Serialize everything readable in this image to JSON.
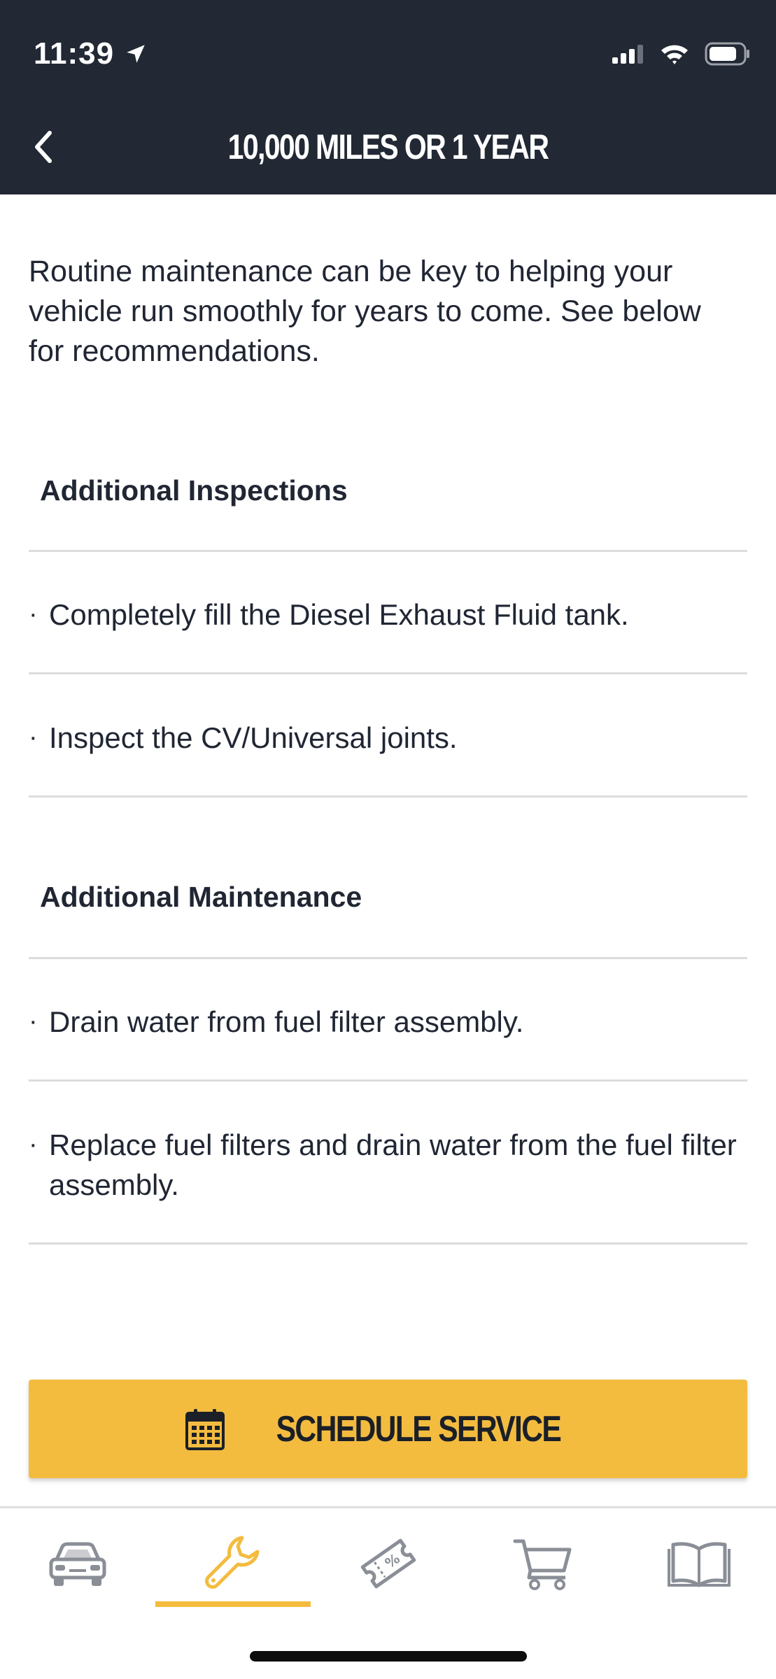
{
  "status_bar": {
    "time": "11:39"
  },
  "header": {
    "title": "10,000 MILES OR 1 YEAR"
  },
  "intro": "Routine maintenance can be key to helping your vehicle run smoothly for years to come.  See below for recommendations.",
  "sections": [
    {
      "title": "Additional Inspections",
      "items": [
        "Completely fill the Diesel Exhaust Fluid tank.",
        "Inspect the CV/Universal joints."
      ]
    },
    {
      "title": "Additional Maintenance",
      "items": [
        "Drain water from fuel filter assembly.",
        "Replace fuel filters and drain water from the fuel filter assembly."
      ]
    }
  ],
  "bullet": "·",
  "schedule_button": {
    "label": "SCHEDULE SERVICE"
  },
  "tabs": [
    {
      "icon": "car-icon",
      "active": false
    },
    {
      "icon": "wrench-icon",
      "active": true
    },
    {
      "icon": "coupon-icon",
      "active": false
    },
    {
      "icon": "cart-icon",
      "active": false
    },
    {
      "icon": "book-icon",
      "active": false
    }
  ],
  "colors": {
    "header_bg": "#222834",
    "accent": "#f3bc3f",
    "icon_gray": "#8a8e96"
  }
}
